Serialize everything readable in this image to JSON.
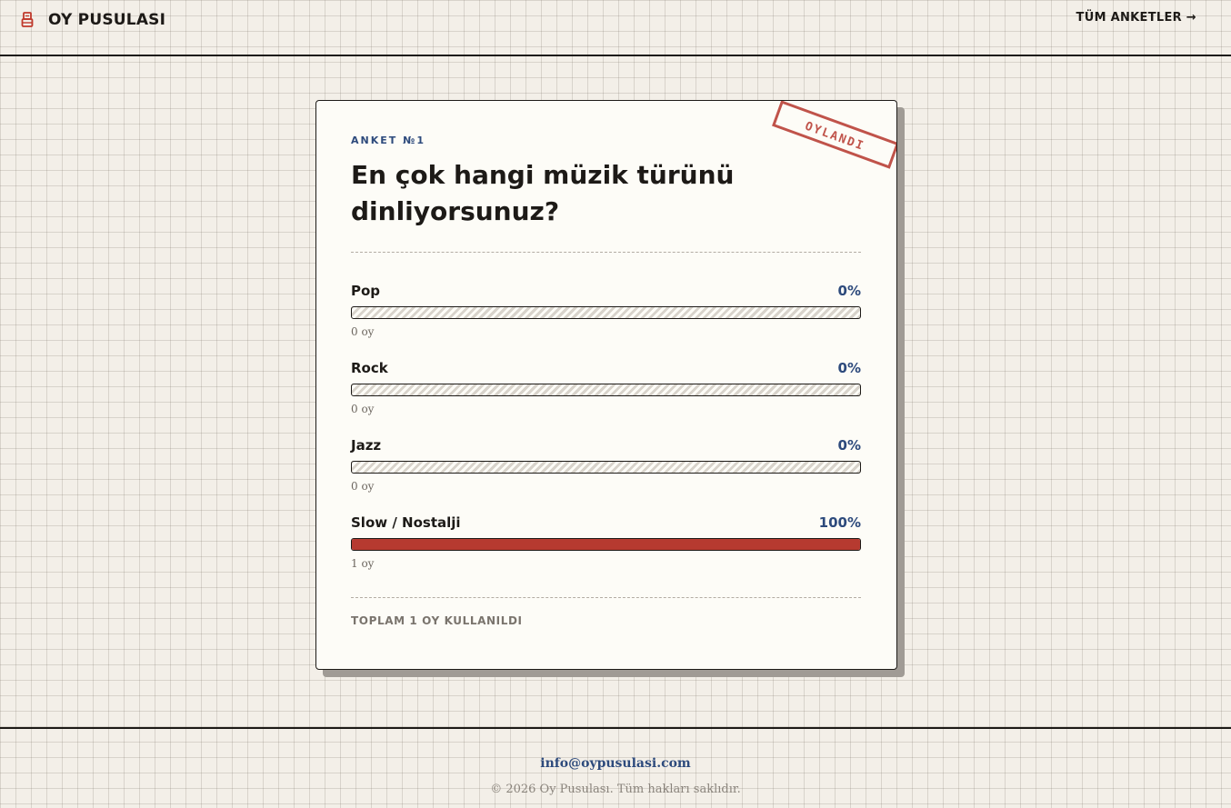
{
  "header": {
    "brand": "OY PUSULASI",
    "brand_icon": "ballot-box-icon",
    "nav_link": "TÜM ANKETLER →"
  },
  "poll": {
    "eyebrow": "ANKET №1",
    "stamp": "OYLANDI",
    "question": "En çok hangi müzik türünü dinliyorsunuz?",
    "options": [
      {
        "label": "Pop",
        "percent": "0%",
        "share": 0,
        "votes": "0 oy"
      },
      {
        "label": "Rock",
        "percent": "0%",
        "share": 0,
        "votes": "0 oy"
      },
      {
        "label": "Jazz",
        "percent": "0%",
        "share": 0,
        "votes": "0 oy"
      },
      {
        "label": "Slow / Nostalji",
        "percent": "100%",
        "share": 1,
        "votes": "1 oy"
      }
    ],
    "total": "TOPLAM 1 OY KULLANILDI"
  },
  "footer": {
    "email": "info@oypusulasi.com",
    "copyright": "© 2026 Oy Pusulası. Tüm hakları saklıdır."
  },
  "colors": {
    "accent_red": "#b63a30",
    "accent_blue": "#2d4a7c",
    "paper": "#f3efe8"
  }
}
